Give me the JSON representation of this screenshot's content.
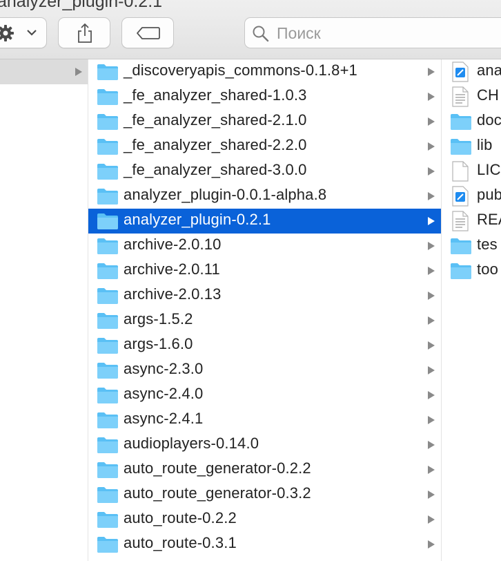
{
  "window": {
    "title": "analyzer_plugin-0.2.1"
  },
  "toolbar": {
    "action_icon": "gear-icon",
    "share_icon": "share-icon",
    "tag_icon": "tag-icon",
    "search_icon": "search-icon",
    "search_placeholder": "Поиск",
    "search_value": ""
  },
  "columns": {
    "col2": {
      "items": [
        {
          "label": "_discoveryapis_commons-0.1.8+1",
          "type": "folder",
          "selected": false
        },
        {
          "label": "_fe_analyzer_shared-1.0.3",
          "type": "folder",
          "selected": false
        },
        {
          "label": "_fe_analyzer_shared-2.1.0",
          "type": "folder",
          "selected": false
        },
        {
          "label": "_fe_analyzer_shared-2.2.0",
          "type": "folder",
          "selected": false
        },
        {
          "label": "_fe_analyzer_shared-3.0.0",
          "type": "folder",
          "selected": false
        },
        {
          "label": "analyzer_plugin-0.0.1-alpha.8",
          "type": "folder",
          "selected": false
        },
        {
          "label": "analyzer_plugin-0.2.1",
          "type": "folder",
          "selected": true
        },
        {
          "label": "archive-2.0.10",
          "type": "folder",
          "selected": false
        },
        {
          "label": "archive-2.0.11",
          "type": "folder",
          "selected": false
        },
        {
          "label": "archive-2.0.13",
          "type": "folder",
          "selected": false
        },
        {
          "label": "args-1.5.2",
          "type": "folder",
          "selected": false
        },
        {
          "label": "args-1.6.0",
          "type": "folder",
          "selected": false
        },
        {
          "label": "async-2.3.0",
          "type": "folder",
          "selected": false
        },
        {
          "label": "async-2.4.0",
          "type": "folder",
          "selected": false
        },
        {
          "label": "async-2.4.1",
          "type": "folder",
          "selected": false
        },
        {
          "label": "audioplayers-0.14.0",
          "type": "folder",
          "selected": false
        },
        {
          "label": "auto_route_generator-0.2.2",
          "type": "folder",
          "selected": false
        },
        {
          "label": "auto_route_generator-0.3.2",
          "type": "folder",
          "selected": false
        },
        {
          "label": "auto_route-0.2.2",
          "type": "folder",
          "selected": false
        },
        {
          "label": "auto_route-0.3.1",
          "type": "folder",
          "selected": false
        }
      ]
    },
    "col3": {
      "items": [
        {
          "label": "ana",
          "type": "xcode-file"
        },
        {
          "label": "CH",
          "type": "text-file"
        },
        {
          "label": "doc",
          "type": "folder"
        },
        {
          "label": "lib",
          "type": "folder"
        },
        {
          "label": "LIC",
          "type": "blank-file"
        },
        {
          "label": "pub",
          "type": "xcode-file"
        },
        {
          "label": "REA",
          "type": "text-file"
        },
        {
          "label": "tes",
          "type": "folder"
        },
        {
          "label": "too",
          "type": "folder"
        }
      ]
    }
  },
  "colors": {
    "selection": "#0a62d9",
    "folder": "#5ac0f5",
    "chevron": "#8a8a8a"
  }
}
